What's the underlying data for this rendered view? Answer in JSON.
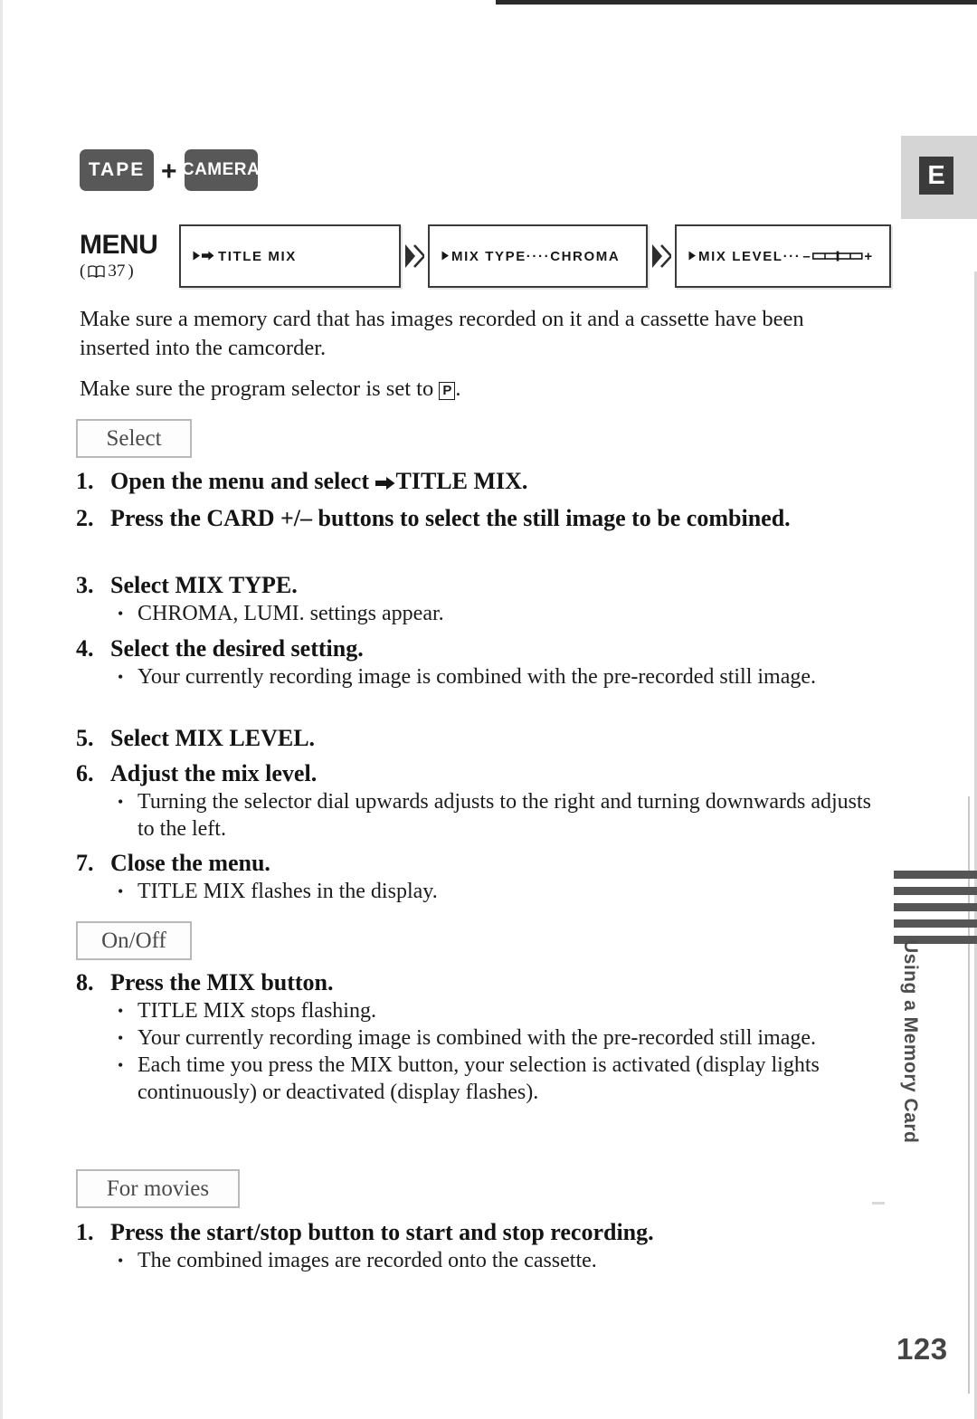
{
  "page": {
    "number": "123",
    "language_tab": "E",
    "side_rail_text": "Using a Memory Card",
    "rail_bar_count": 5
  },
  "mode_row": {
    "badges": [
      {
        "label": "TAPE",
        "name": "tape-mode-badge"
      },
      {
        "label": "CAMERA",
        "name": "camera-mode-badge"
      }
    ],
    "separator": "+"
  },
  "menu_flow": {
    "label": "MENU",
    "reference_open": "(",
    "reference_page": "37",
    "reference_close": ")",
    "book_icon": "book-icon",
    "arrow_icon": "double-chevron-icon",
    "screens": [
      {
        "prefix_icon": "play-arrow-icon",
        "arrow_icon": "right-arrow-icon",
        "text": "TITLE MIX"
      },
      {
        "prefix_icon": "play-arrow-icon",
        "text": "MIX TYPE····CHROMA"
      },
      {
        "prefix_icon": "play-arrow-icon",
        "text": "MIX LEVEL···",
        "slider": "mix-level-slider",
        "minus": "–",
        "plus": "+"
      }
    ]
  },
  "intro": {
    "paragraph_1": "Make sure a memory card that has images recorded on it and a cassette have been inserted into the camcorder.",
    "paragraph_2_before": "Make sure the program selector is set to ",
    "paragraph_2_icon": "P",
    "paragraph_2_after": "."
  },
  "sections": [
    {
      "tag": "Select"
    },
    {
      "tag": "On/Off"
    },
    {
      "tag": "For movies"
    }
  ],
  "tags": {
    "select": "Select",
    "onoff": "On/Off",
    "for_movies": "For movies"
  },
  "steps": [
    {
      "num": "1.",
      "title_before": "Open the menu and select ",
      "title_arrow": "right-arrow-icon",
      "title_after": "TITLE MIX.",
      "bullets": []
    },
    {
      "num": "2.",
      "title": "Press the CARD +/– buttons to select the still image to be combined.",
      "bullets": []
    },
    {
      "num": "3.",
      "title": "Select MIX TYPE.",
      "bullets": [
        "CHROMA, LUMI. settings appear."
      ]
    },
    {
      "num": "4.",
      "title": "Select the desired setting.",
      "bullets": [
        "Your currently recording image is combined with the pre-recorded still image."
      ]
    },
    {
      "num": "5.",
      "title": "Select MIX LEVEL.",
      "bullets": []
    },
    {
      "num": "6.",
      "title": "Adjust the mix level.",
      "bullets": [
        "Turning the selector dial upwards adjusts to the right and turning downwards adjusts to the left."
      ]
    },
    {
      "num": "7.",
      "title": "Close the menu.",
      "bullets": [
        "TITLE MIX flashes in the display."
      ]
    },
    {
      "num": "8.",
      "title": "Press the MIX button.",
      "bullets": [
        "TITLE MIX stops flashing.",
        "Your currently recording image is combined with the pre-recorded still image.",
        "Each time you press the MIX button, your selection is activated (display lights continuously) or deactivated (display flashes)."
      ]
    }
  ],
  "movie_step": {
    "num": "1.",
    "title": "Press the start/stop button to start and stop recording.",
    "bullets": [
      "The combined images are recorded onto the cassette."
    ]
  },
  "bullet_char": "•",
  "colors": {
    "badge_fill": "#585858",
    "text": "#1c1c1c",
    "rail": "#555555",
    "tag_border": "#b9b9b9",
    "page_number": "#444444"
  }
}
